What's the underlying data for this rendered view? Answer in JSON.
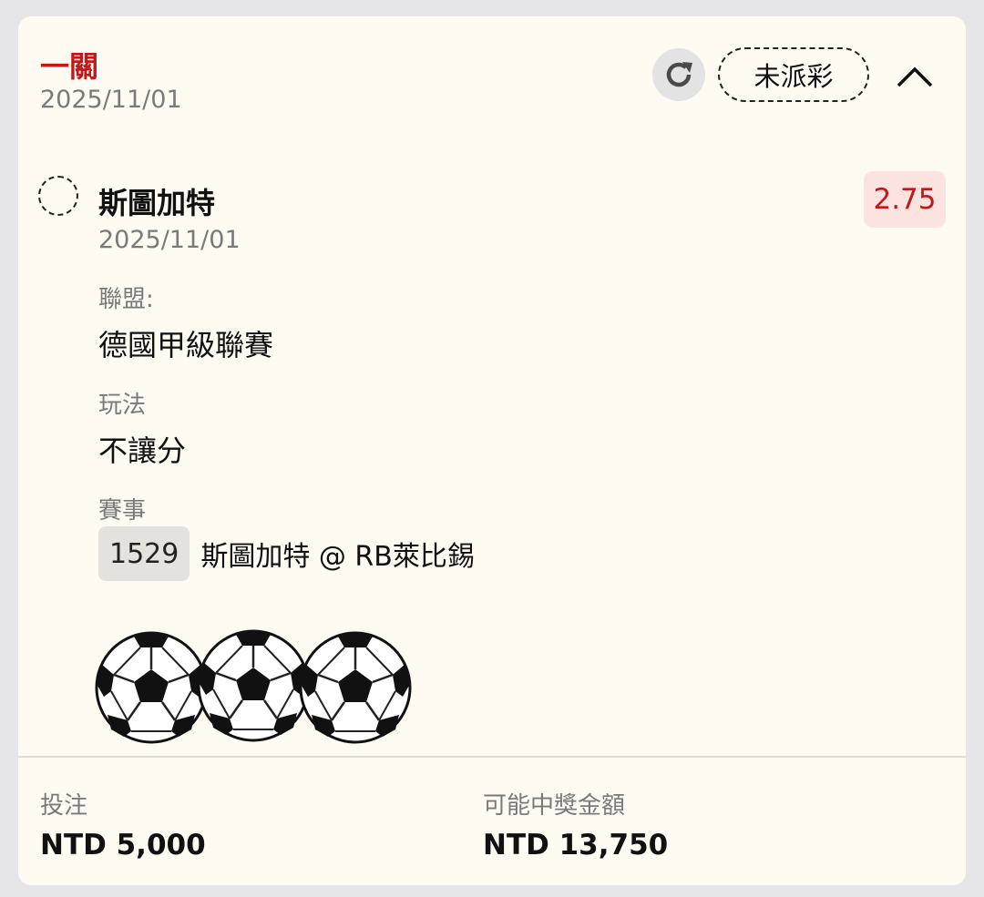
{
  "ticket": {
    "bet_type": "一關",
    "date": "2025/11/01",
    "status": "未派彩",
    "refresh_icon": "refresh-icon",
    "collapse_icon": "chevron-up-icon"
  },
  "selection": {
    "team": "斯圖加特",
    "date": "2025/11/01",
    "odds": "2.75",
    "league_label": "聯盟:",
    "league_value": "德國甲級聯賽",
    "play_label": "玩法",
    "play_value": "不讓分",
    "event_label": "賽事",
    "event_number": "1529",
    "event_teams": "斯圖加特 @ RB萊比錫"
  },
  "footer": {
    "stake_label": "投注",
    "stake_value": "NTD 5,000",
    "payout_label": "可能中獎金額",
    "payout_value": "NTD 13,750"
  },
  "colors": {
    "accent_red": "#c1181c",
    "card_bg": "#fdfbf2",
    "odds_bg": "#fbe3df"
  },
  "stickers": [
    "soccer-ball-icon",
    "soccer-ball-icon",
    "soccer-ball-icon"
  ]
}
